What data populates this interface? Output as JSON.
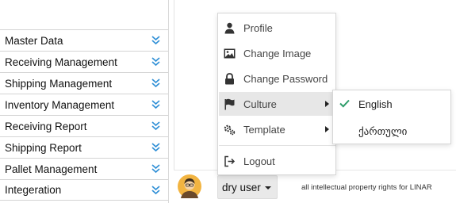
{
  "sidebar": {
    "items": [
      {
        "label": "Master Data"
      },
      {
        "label": "Receiving Management"
      },
      {
        "label": "Shipping Management"
      },
      {
        "label": "Inventory Management"
      },
      {
        "label": "Receiving Report"
      },
      {
        "label": "Shipping Report"
      },
      {
        "label": "Pallet Management"
      },
      {
        "label": "Integeration"
      }
    ],
    "chevron_icon": "double-chevron-down-icon",
    "accent_color": "#2f8fd6"
  },
  "user_menu": {
    "items": [
      {
        "label": "Profile",
        "icon": "user-icon"
      },
      {
        "label": "Change Image",
        "icon": "image-icon"
      },
      {
        "label": "Change Password",
        "icon": "lock-icon"
      },
      {
        "label": "Culture",
        "icon": "flag-icon",
        "has_submenu": true,
        "active": true
      },
      {
        "label": "Template",
        "icon": "cogs-icon",
        "has_submenu": true
      },
      {
        "label": "Logout",
        "icon": "logout-icon"
      }
    ]
  },
  "culture_submenu": {
    "items": [
      {
        "label": "English",
        "selected": true
      },
      {
        "label": "ქართული",
        "selected": false
      }
    ],
    "check_color": "#2e9c6a"
  },
  "footer": {
    "user_name": "dry user",
    "copyright": "all intellectual property rights for LINAR"
  }
}
